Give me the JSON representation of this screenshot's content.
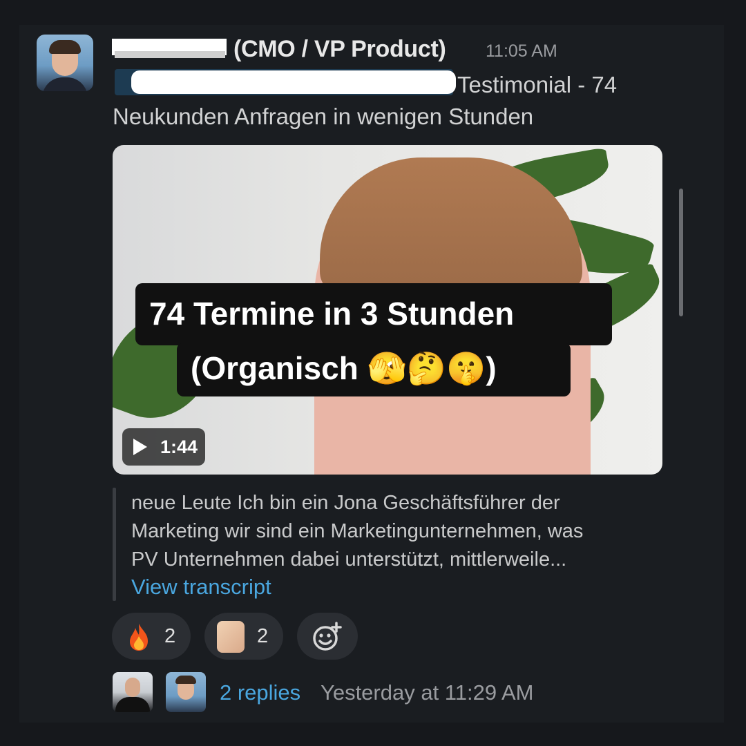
{
  "message": {
    "sender_suffix": "(CMO / VP Product)",
    "time": "11:05 AM",
    "text_line1_tail": "Testimonial - 74",
    "text_line2": "Neukunden Anfragen in wenigen Stunden"
  },
  "video": {
    "overlay_line1": "74 Termine in 3 Stunden",
    "overlay_line2": "(Organisch 🫣🤔🤫)",
    "duration": "1:44",
    "icon_play": "play-icon"
  },
  "transcript": {
    "line1": "neue Leute Ich bin ein Jona Geschäftsführer der",
    "line2": "Marketing wir sind ein Marketingunternehmen, was",
    "line3": "PV Unternehmen dabei unterstützt, mittlerweile...",
    "view_label": "View transcript"
  },
  "reactions": [
    {
      "emoji": "🔥",
      "name": "fire",
      "count": "2"
    },
    {
      "emoji": "thumb",
      "name": "custom-thumb",
      "count": "2"
    }
  ],
  "add_reaction_icon": "add-reaction-icon",
  "thread": {
    "replies_label": "2 replies",
    "last_reply": "Yesterday at 11:29 AM"
  },
  "colors": {
    "background": "#1a1d21",
    "link": "#4aa7e0",
    "pill": "#2b2e33"
  }
}
